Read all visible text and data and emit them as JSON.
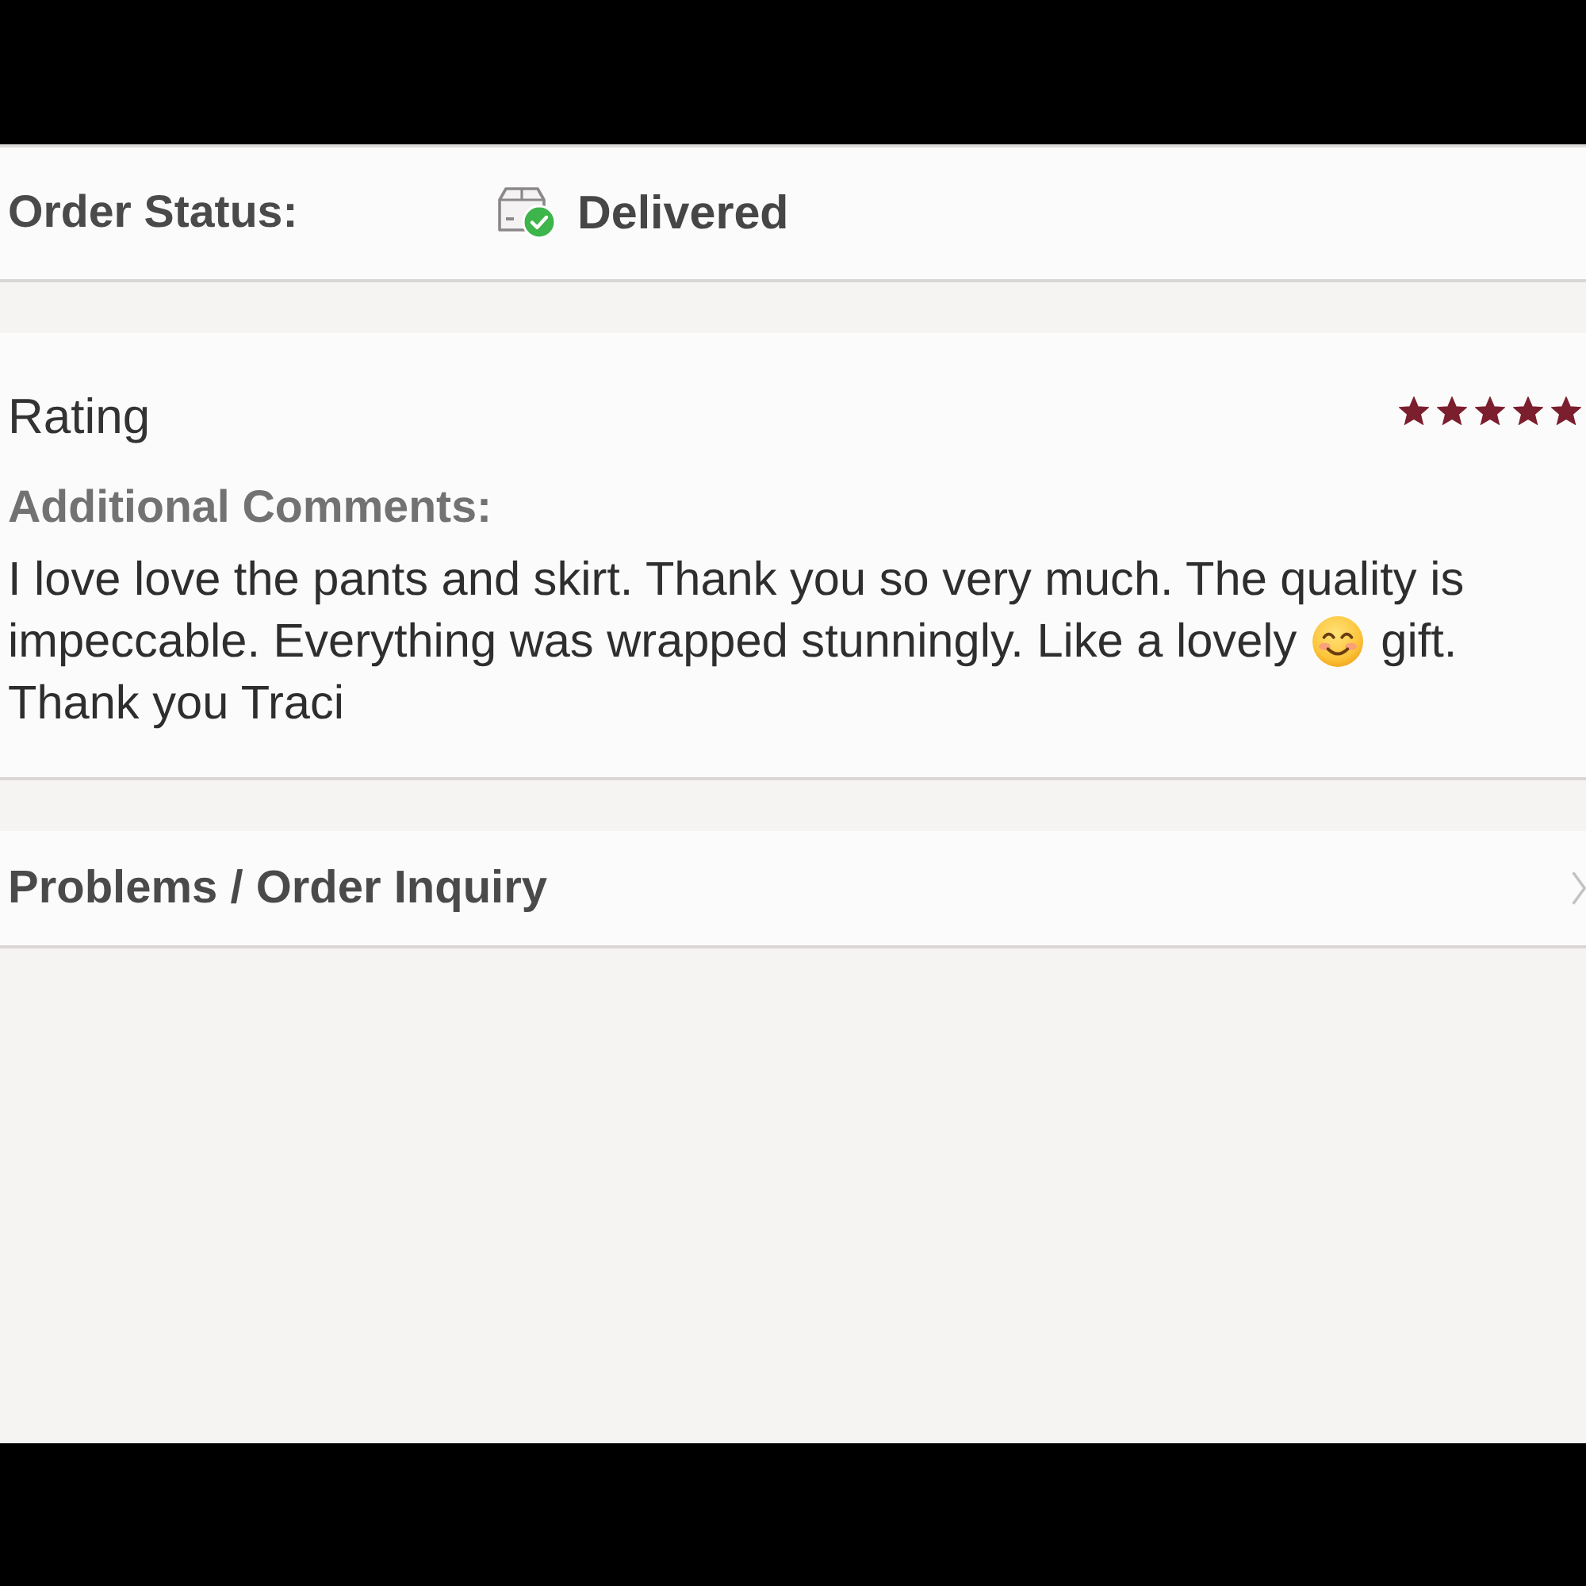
{
  "order_status": {
    "label": "Order Status:",
    "value": "Delivered"
  },
  "rating": {
    "title": "Rating",
    "stars": 5
  },
  "comments": {
    "label": "Additional Comments:",
    "lines": [
      [
        {
          "kind": "text",
          "text": "I love love the pants and skirt. Thank you so very much. The quality is"
        }
      ],
      [
        {
          "kind": "text",
          "text": "impeccable. Everything was wrapped stunningly. Like a lovely"
        },
        {
          "kind": "emoji"
        },
        {
          "kind": "text",
          "text": "gift."
        }
      ],
      [
        {
          "kind": "text",
          "text": "Thank you Traci"
        }
      ]
    ]
  },
  "inquiry": {
    "label": "Problems / Order Inquiry"
  }
}
